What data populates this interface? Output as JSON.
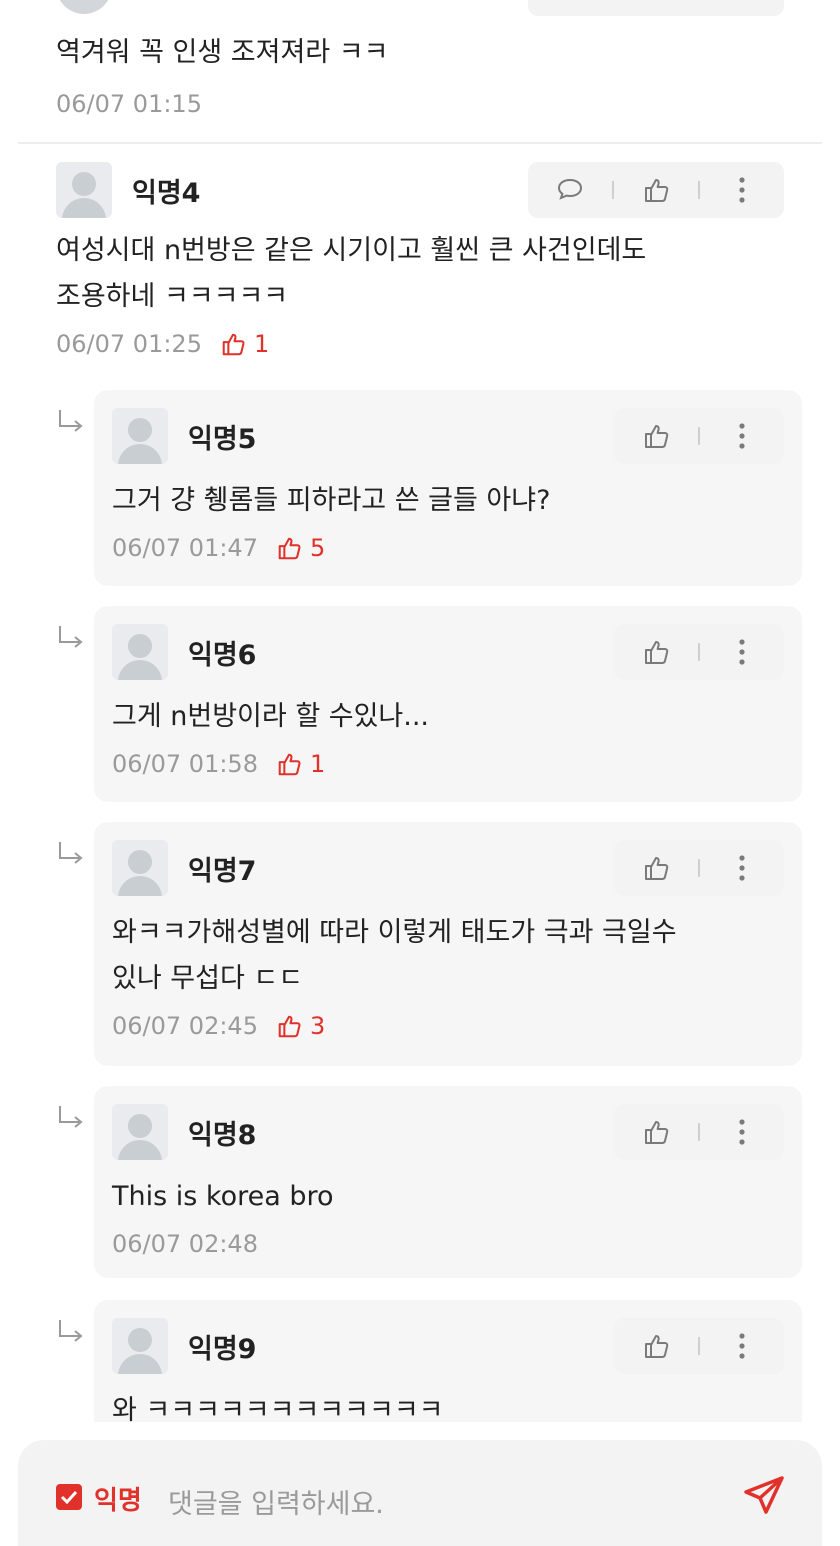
{
  "top_comment": {
    "text": "역겨워 꼭 인생 조져져라 ㅋㅋ",
    "date": "06/07 01:15"
  },
  "comment4": {
    "name": "익명4",
    "text_line1": "여성시대 n번방은 같은 시기이고 훨씬 큰 사건인데도",
    "text_line2": "조용하네 ㅋㅋㅋㅋㅋ",
    "date": "06/07 01:25",
    "likes": "1"
  },
  "replies": [
    {
      "name": "익명5",
      "text": "그거 걍 췡롬들 피하라고 쓴 글들 아냐?",
      "date": "06/07 01:47",
      "likes": "5"
    },
    {
      "name": "익명6",
      "text": "그게 n번방이라 할 수있나...",
      "date": "06/07 01:58",
      "likes": "1"
    },
    {
      "name": "익명7",
      "text_line1": "와ㅋㅋ가해성별에 따라 이렇게 태도가 극과 극일수",
      "text_line2": "있나 무섭다 ㄷㄷ",
      "date": "06/07 02:45",
      "likes": "3"
    },
    {
      "name": "익명8",
      "text": "This is korea bro",
      "date": "06/07 02:48"
    },
    {
      "name": "익명9",
      "text": "와 ㅋㅋㅋㅋㅋㅋㅋㅋㅋㅋㅋㅋ"
    }
  ],
  "composer": {
    "anon_label": "익명",
    "anon_checked": true,
    "placeholder": "댓글을 입력하세요."
  },
  "colors": {
    "accent": "#e0312a",
    "muted": "#9a9a9a",
    "reply_bg": "#f6f6f6"
  },
  "icons": [
    "comment-icon",
    "thumbs-up-icon",
    "more-vertical-icon",
    "reply-arrow-icon",
    "send-icon",
    "checkbox-icon"
  ]
}
